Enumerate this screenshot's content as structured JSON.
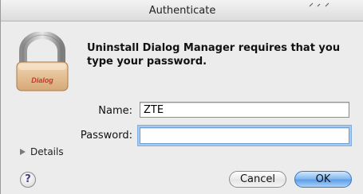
{
  "window": {
    "title": "Authenticate"
  },
  "dialog": {
    "message": "Uninstall Dialog Manager requires that you type your password.",
    "lock_badge_text": "Dialog"
  },
  "form": {
    "name_label": "Name:",
    "name_value": "ZTE",
    "password_label": "Password:",
    "password_value": ""
  },
  "details": {
    "label": "Details"
  },
  "buttons": {
    "help_label": "?",
    "cancel_label": "Cancel",
    "ok_label": "OK"
  },
  "icons": {
    "lock": "padlock-icon",
    "details": "disclosure-triangle-icon",
    "help": "help-icon"
  },
  "colors": {
    "focus_ring": "#7eaee3",
    "default_button": "#5a9be6",
    "badge_text": "#c0392b"
  }
}
